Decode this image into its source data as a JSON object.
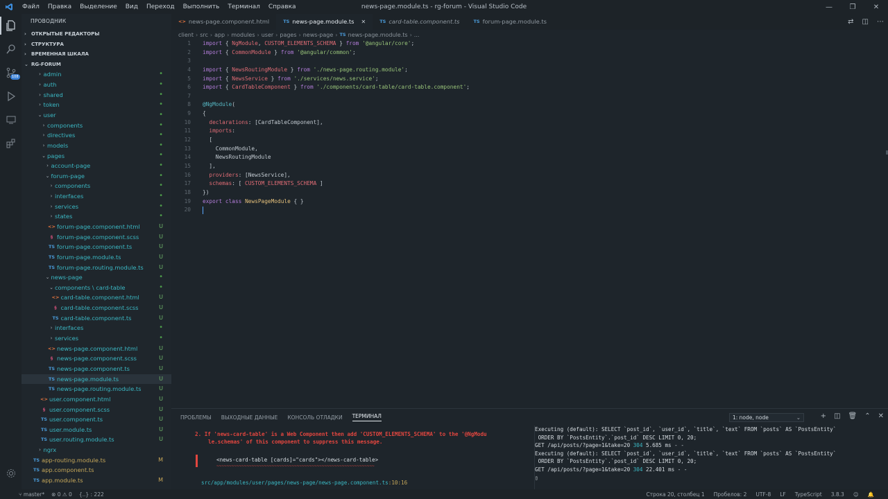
{
  "titlebar": {
    "menu": [
      "Файл",
      "Правка",
      "Выделение",
      "Вид",
      "Переход",
      "Выполнить",
      "Терминал",
      "Справка"
    ],
    "window_title": "news-page.module.ts - rg-forum - Visual Studio Code"
  },
  "activity": {
    "scm_badge": "108"
  },
  "sidebar": {
    "header": "ПРОВОДНИК",
    "sections": [
      "ОТКРЫТЫЕ РЕДАКТОРЫ",
      "СТРУКТУРА",
      "ВРЕМЕННАЯ ШКАЛА"
    ],
    "root": "RG-FORUM",
    "tree": [
      {
        "label": "admin",
        "indent": 1,
        "chev": "›",
        "kind": "folder",
        "status": "•"
      },
      {
        "label": "auth",
        "indent": 1,
        "chev": "›",
        "kind": "folder",
        "status": "•"
      },
      {
        "label": "shared",
        "indent": 1,
        "chev": "›",
        "kind": "folder",
        "status": "•"
      },
      {
        "label": "token",
        "indent": 1,
        "chev": "›",
        "kind": "folder",
        "status": "•"
      },
      {
        "label": "user",
        "indent": 1,
        "chev": "⌄",
        "kind": "folder",
        "status": "•"
      },
      {
        "label": "components",
        "indent": 2,
        "chev": "›",
        "kind": "folder",
        "status": "•"
      },
      {
        "label": "directives",
        "indent": 2,
        "chev": "›",
        "kind": "folder",
        "status": "•"
      },
      {
        "label": "models",
        "indent": 2,
        "chev": "›",
        "kind": "folder",
        "status": "•"
      },
      {
        "label": "pages",
        "indent": 2,
        "chev": "⌄",
        "kind": "folder",
        "status": "•"
      },
      {
        "label": "account-page",
        "indent": 3,
        "chev": "›",
        "kind": "folder",
        "status": "•"
      },
      {
        "label": "forum-page",
        "indent": 3,
        "chev": "⌄",
        "kind": "folder",
        "status": "•"
      },
      {
        "label": "components",
        "indent": 4,
        "chev": "›",
        "kind": "folder",
        "status": "•"
      },
      {
        "label": "interfaces",
        "indent": 4,
        "chev": "›",
        "kind": "folder",
        "status": "•"
      },
      {
        "label": "services",
        "indent": 4,
        "chev": "›",
        "kind": "folder",
        "status": "•"
      },
      {
        "label": "states",
        "indent": 4,
        "chev": "›",
        "kind": "folder",
        "status": "•"
      },
      {
        "label": "forum-page.component.html",
        "indent": 4,
        "chev": "",
        "kind": "html",
        "status": "U"
      },
      {
        "label": "forum-page.component.scss",
        "indent": 4,
        "chev": "",
        "kind": "scss",
        "status": "U"
      },
      {
        "label": "forum-page.component.ts",
        "indent": 4,
        "chev": "",
        "kind": "ts",
        "status": "U"
      },
      {
        "label": "forum-page.module.ts",
        "indent": 4,
        "chev": "",
        "kind": "ts",
        "status": "U"
      },
      {
        "label": "forum-page.routing.module.ts",
        "indent": 4,
        "chev": "",
        "kind": "ts",
        "status": "U"
      },
      {
        "label": "news-page",
        "indent": 3,
        "chev": "⌄",
        "kind": "folder",
        "status": "•"
      },
      {
        "label": "components \\ card-table",
        "indent": 4,
        "chev": "⌄",
        "kind": "folder",
        "status": "•"
      },
      {
        "label": "card-table.component.html",
        "indent": 5,
        "chev": "",
        "kind": "html",
        "status": "U"
      },
      {
        "label": "card-table.component.scss",
        "indent": 5,
        "chev": "",
        "kind": "scss",
        "status": "U"
      },
      {
        "label": "card-table.component.ts",
        "indent": 5,
        "chev": "",
        "kind": "ts",
        "status": "U"
      },
      {
        "label": "interfaces",
        "indent": 4,
        "chev": "›",
        "kind": "folder",
        "status": "•"
      },
      {
        "label": "services",
        "indent": 4,
        "chev": "›",
        "kind": "folder",
        "status": "•"
      },
      {
        "label": "news-page.component.html",
        "indent": 4,
        "chev": "",
        "kind": "html",
        "status": "U"
      },
      {
        "label": "news-page.component.scss",
        "indent": 4,
        "chev": "",
        "kind": "scss",
        "status": "U"
      },
      {
        "label": "news-page.component.ts",
        "indent": 4,
        "chev": "",
        "kind": "ts",
        "status": "U"
      },
      {
        "label": "news-page.module.ts",
        "indent": 4,
        "chev": "",
        "kind": "ts",
        "status": "U",
        "selected": true
      },
      {
        "label": "news-page.routing.module.ts",
        "indent": 4,
        "chev": "",
        "kind": "ts",
        "status": "U"
      },
      {
        "label": "user.component.html",
        "indent": 2,
        "chev": "",
        "kind": "html",
        "status": "U"
      },
      {
        "label": "user.component.scss",
        "indent": 2,
        "chev": "",
        "kind": "scss",
        "status": "U"
      },
      {
        "label": "user.component.ts",
        "indent": 2,
        "chev": "",
        "kind": "ts",
        "status": "U"
      },
      {
        "label": "user.module.ts",
        "indent": 2,
        "chev": "",
        "kind": "ts",
        "status": "U"
      },
      {
        "label": "user.routing.module.ts",
        "indent": 2,
        "chev": "",
        "kind": "ts",
        "status": "U"
      },
      {
        "label": "ngrx",
        "indent": 1,
        "chev": "›",
        "kind": "folder",
        "status": ""
      },
      {
        "label": "app-routing.module.ts",
        "indent": 0,
        "chev": "",
        "kind": "ts",
        "status": "M",
        "yellow": true
      },
      {
        "label": "app.component.ts",
        "indent": 0,
        "chev": "",
        "kind": "ts",
        "status": "",
        "yellow": true
      },
      {
        "label": "app.module.ts",
        "indent": 0,
        "chev": "",
        "kind": "ts",
        "status": "M",
        "yellow": true
      }
    ]
  },
  "tabs": [
    {
      "label": "news-page.component.html",
      "icon": "<>",
      "kind": "html",
      "active": false,
      "italic": false
    },
    {
      "label": "news-page.module.ts",
      "icon": "TS",
      "kind": "ts",
      "active": true,
      "italic": false
    },
    {
      "label": "card-table.component.ts",
      "icon": "TS",
      "kind": "ts",
      "active": false,
      "italic": true
    },
    {
      "label": "forum-page.module.ts",
      "icon": "TS",
      "kind": "ts",
      "active": false,
      "italic": false
    }
  ],
  "breadcrumb": [
    "client",
    "src",
    "app",
    "modules",
    "user",
    "pages",
    "news-page",
    "news-page.module.ts",
    "..."
  ],
  "code": [
    [
      [
        "kw",
        "import"
      ],
      [
        "p",
        " { "
      ],
      [
        "id",
        "NgModule"
      ],
      [
        "p",
        ", "
      ],
      [
        "id",
        "CUSTOM_ELEMENTS_SCHEMA"
      ],
      [
        "p",
        " } "
      ],
      [
        "kw",
        "from"
      ],
      [
        "p",
        " "
      ],
      [
        "str",
        "'@angular/core'"
      ],
      [
        "p",
        ";"
      ]
    ],
    [
      [
        "kw",
        "import"
      ],
      [
        "p",
        " { "
      ],
      [
        "id",
        "CommonModule"
      ],
      [
        "p",
        " } "
      ],
      [
        "kw",
        "from"
      ],
      [
        "p",
        " "
      ],
      [
        "str",
        "'@angular/common'"
      ],
      [
        "p",
        ";"
      ]
    ],
    [],
    [
      [
        "kw",
        "import"
      ],
      [
        "p",
        " { "
      ],
      [
        "id",
        "NewsRoutingModule"
      ],
      [
        "p",
        " } "
      ],
      [
        "kw",
        "from"
      ],
      [
        "p",
        " "
      ],
      [
        "str",
        "'./news-page.routing.module'"
      ],
      [
        "p",
        ";"
      ]
    ],
    [
      [
        "kw",
        "import"
      ],
      [
        "p",
        " { "
      ],
      [
        "id",
        "NewsService"
      ],
      [
        "p",
        " } "
      ],
      [
        "kw",
        "from"
      ],
      [
        "p",
        " "
      ],
      [
        "str",
        "'./services/news.service'"
      ],
      [
        "p",
        ";"
      ]
    ],
    [
      [
        "kw",
        "import"
      ],
      [
        "p",
        " { "
      ],
      [
        "id",
        "CardTableComponent"
      ],
      [
        "p",
        " } "
      ],
      [
        "kw",
        "from"
      ],
      [
        "p",
        " "
      ],
      [
        "str",
        "'./components/card-table/card-table.component'"
      ],
      [
        "p",
        ";"
      ]
    ],
    [],
    [
      [
        "dec",
        "@NgModule"
      ],
      [
        "p",
        "("
      ]
    ],
    [
      [
        "p",
        "{"
      ]
    ],
    [
      [
        "p",
        "  "
      ],
      [
        "prop",
        "declarations"
      ],
      [
        "p",
        ": [CardTableComponent],"
      ]
    ],
    [
      [
        "p",
        "  "
      ],
      [
        "prop",
        "imports"
      ],
      [
        "p",
        ":"
      ]
    ],
    [
      [
        "p",
        "  ["
      ]
    ],
    [
      [
        "p",
        "    CommonModule,"
      ]
    ],
    [
      [
        "p",
        "    NewsRoutingModule"
      ]
    ],
    [
      [
        "p",
        "  ],"
      ]
    ],
    [
      [
        "p",
        "  "
      ],
      [
        "prop",
        "providers"
      ],
      [
        "p",
        ": [NewsService],"
      ]
    ],
    [
      [
        "p",
        "  "
      ],
      [
        "prop",
        "schemas"
      ],
      [
        "p",
        ": [ "
      ],
      [
        "id",
        "CUSTOM_ELEMENTS_SCHEMA"
      ],
      [
        "p",
        " ]"
      ]
    ],
    [
      [
        "p",
        "})"
      ]
    ],
    [
      [
        "kw",
        "export"
      ],
      [
        "p",
        " "
      ],
      [
        "kw",
        "class"
      ],
      [
        "p",
        " "
      ],
      [
        "cls",
        "NewsPageModule"
      ],
      [
        "p",
        " { }"
      ]
    ],
    []
  ],
  "panel": {
    "tabs": [
      "ПРОБЛЕМЫ",
      "ВЫХОДНЫЕ ДАННЫЕ",
      "КОНСОЛЬ ОТЛАДКИ",
      "ТЕРМИНАЛ"
    ],
    "terminal_select": "1: node, node",
    "left": {
      "err1": "2. If 'news-card-table' is a Web Component then add 'CUSTOM_ELEMENTS_SCHEMA' to the '@NgModu",
      "err2": "le.schemas' of this component to suppress this message.",
      "snippet": "<news-card-table [cards]=\"cards\"></news-card-table>",
      "squiggle": "~~~~~~~~~~~~~~~~~~~~~~~~~~~~~~~~~~~~~~~~~~~~~~~~~~~~~~~~~~~~~~~",
      "path": "src/app/modules/user/pages/news-page/news-page.component.ts",
      "pos": ":10:16"
    },
    "right": [
      "Executing (default): SELECT `post_id`, `user_id`, `title`, `text` FROM `posts` AS `PostsEntity`",
      " ORDER BY `PostsEntity`.`post_id` DESC LIMIT 0, 20;",
      "GET /api/posts/?page=1&take=20 |304| 5.685 ms - -",
      "Executing (default): SELECT `post_id`, `user_id`, `title`, `text` FROM `posts` AS `PostsEntity`",
      " ORDER BY `PostsEntity`.`post_id` DESC LIMIT 0, 20;",
      "GET /api/posts/?page=1&take=20 |304| 22.401 ms - -"
    ]
  },
  "status": {
    "branch": "master*",
    "problems": "⊗ 0 ⚠ 0",
    "selection": "{..} : 222",
    "position": "Строка 20, столбец 1",
    "spaces": "Пробелов: 2",
    "encoding": "UTF-8",
    "eol": "LF",
    "language": "TypeScript",
    "version": "3.8.3"
  },
  "colors": {
    "accent": "#3bb8c4",
    "error": "#e2463f",
    "bg": "#1e252b"
  }
}
